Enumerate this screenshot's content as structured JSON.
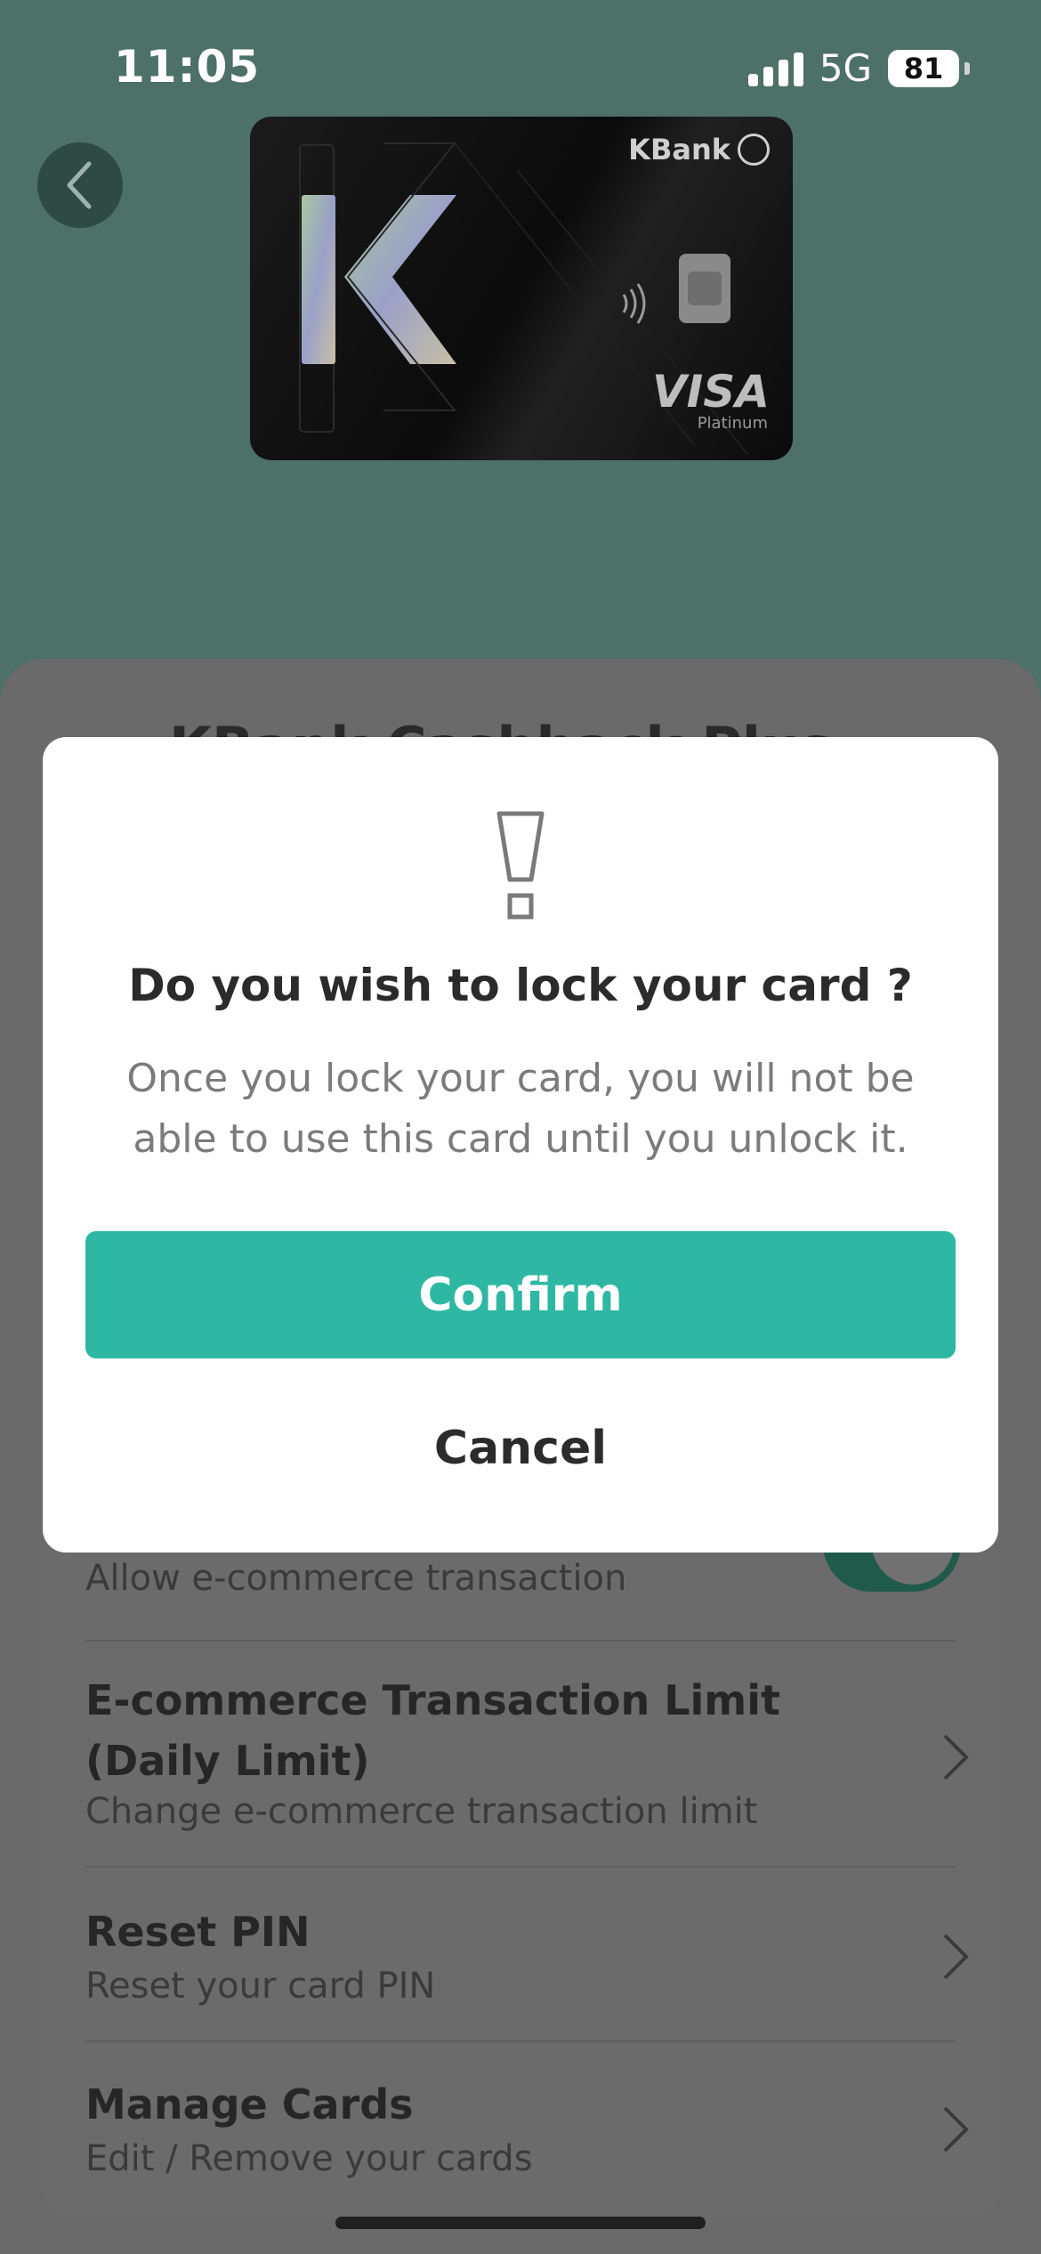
{
  "status_bar": {
    "time": "11:05",
    "network": "5G",
    "battery": "81"
  },
  "card": {
    "bank_name": "KBank",
    "network_brand": "VISA",
    "tier": "Platinum"
  },
  "page": {
    "title": "KBank Cashback Plus"
  },
  "settings": [
    {
      "title": "",
      "subtitle": "Allow e-commerce transaction"
    },
    {
      "title_line1": "E-commerce Transaction Limit",
      "title_line2": "(Daily Limit)",
      "subtitle": "Change e-commerce transaction limit"
    },
    {
      "title": "Reset PIN",
      "subtitle": "Reset your card PIN"
    },
    {
      "title": "Manage Cards",
      "subtitle": "Edit / Remove your cards"
    }
  ],
  "dialog": {
    "title": "Do you wish to lock your card ?",
    "message": "Once you lock your card, you will not be able to use this card until you unlock it.",
    "confirm_label": "Confirm",
    "cancel_label": "Cancel"
  },
  "colors": {
    "accent": "#2eb8a3",
    "overlay": "#4d7068"
  }
}
